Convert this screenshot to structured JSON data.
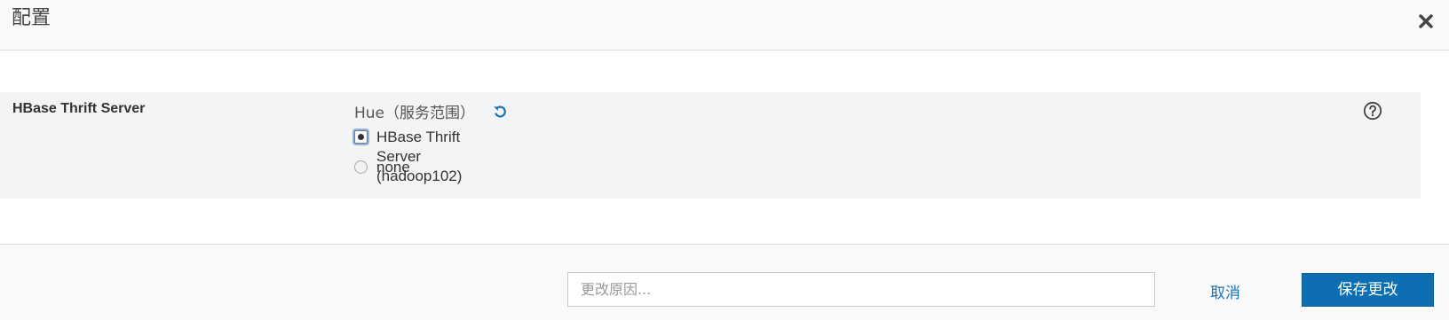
{
  "dialog": {
    "title": "配置",
    "close_icon": "close-icon"
  },
  "config": {
    "label": "HBase Thrift Server",
    "scope": "Hue（服务范围）",
    "revert_icon": "revert-icon",
    "help_icon": "help-icon",
    "options": [
      {
        "label": "HBase Thrift Server (hadoop102)",
        "selected": true
      },
      {
        "label": "none",
        "selected": false
      }
    ]
  },
  "footer": {
    "reason_placeholder": "更改原因...",
    "reason_value": "",
    "cancel_label": "取消",
    "save_label": "保存更改"
  },
  "colors": {
    "accent": "#0d6fb1",
    "link": "#1a73b5",
    "row_background": "#f3f4f5",
    "header_background": "#f9f9fa"
  }
}
